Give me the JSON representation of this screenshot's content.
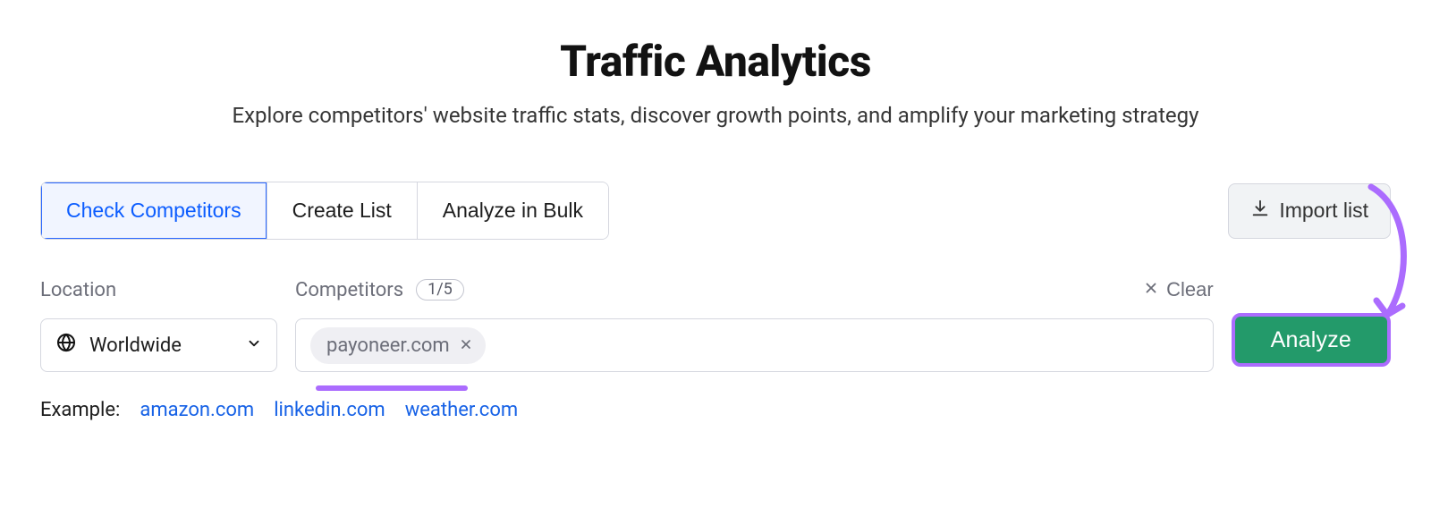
{
  "header": {
    "title": "Traffic Analytics",
    "subtitle": "Explore competitors' website traffic stats, discover growth points, and amplify your marketing strategy"
  },
  "tabs": {
    "items": [
      {
        "label": "Check Competitors",
        "active": true
      },
      {
        "label": "Create List",
        "active": false
      },
      {
        "label": "Analyze in Bulk",
        "active": false
      }
    ],
    "import_label": "Import list"
  },
  "location": {
    "label": "Location",
    "value": "Worldwide"
  },
  "competitors": {
    "label": "Competitors",
    "count_badge": "1/5",
    "clear_label": "Clear",
    "chips": [
      {
        "text": "payoneer.com"
      }
    ]
  },
  "analyze_label": "Analyze",
  "examples": {
    "label": "Example:",
    "links": [
      "amazon.com",
      "linkedin.com",
      "weather.com"
    ]
  }
}
